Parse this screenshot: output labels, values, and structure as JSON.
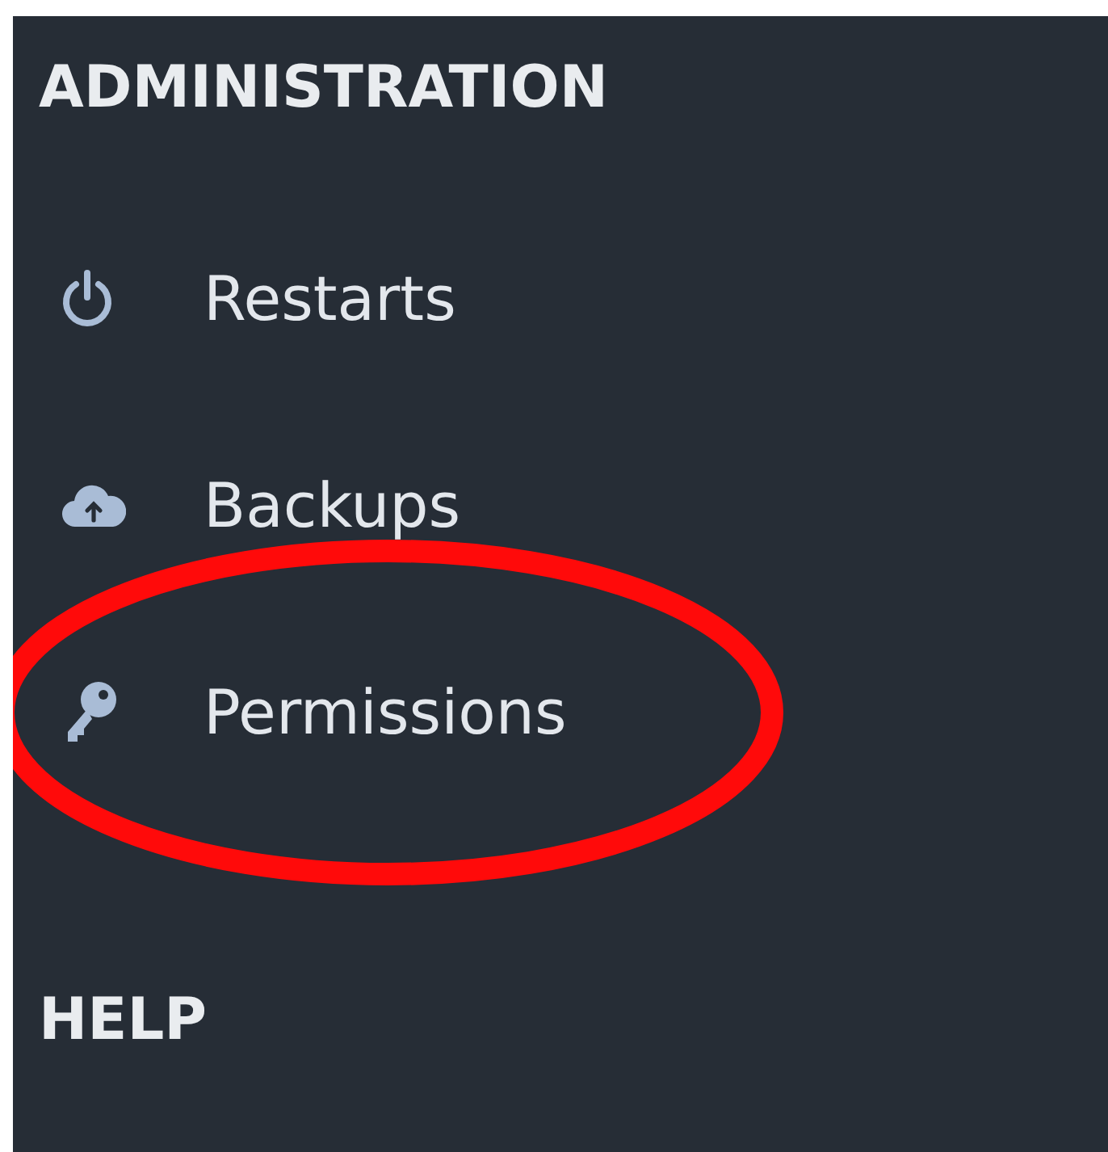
{
  "sections": [
    {
      "title": "ADMINISTRATION",
      "items": [
        {
          "kind": "power",
          "label": "Restarts",
          "circled": false
        },
        {
          "kind": "cloud",
          "label": "Backups",
          "circled": false
        },
        {
          "kind": "key",
          "label": "Permissions",
          "circled": true
        }
      ]
    },
    {
      "title": "HELP"
    }
  ]
}
